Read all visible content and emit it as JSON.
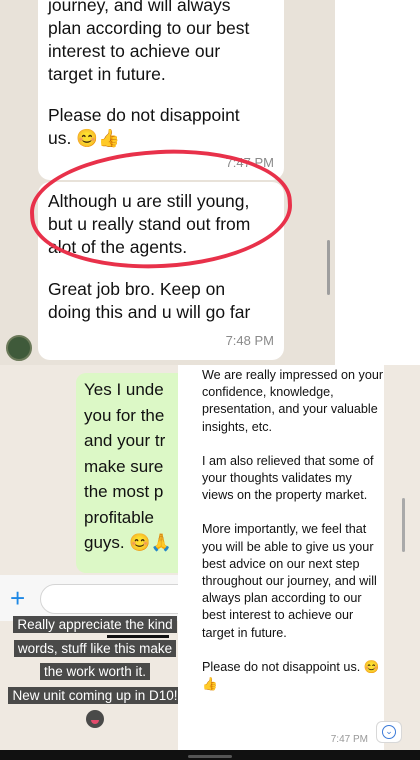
{
  "top_chat": {
    "message1": {
      "lines": [
        "journey, and will always",
        "plan according to our best",
        "interest to achieve our",
        "target in future."
      ],
      "line2": "Please do not disappoint",
      "line3": "us. 😊👍",
      "time": "7:47 PM"
    },
    "message2": {
      "para1": [
        "Although u are still young,",
        "but u really stand out from",
        "alot of the agents."
      ],
      "para2": [
        "Great job bro. Keep on",
        "doing this and u will go far"
      ],
      "time": "7:48 PM"
    }
  },
  "reply_bubble": {
    "lines": [
      "Yes I unde",
      "you for the",
      "and your tr",
      "make sure",
      "the most p",
      "profitable",
      "guys. 😊🙏"
    ]
  },
  "caption": {
    "line1": "Really appreciate the kind",
    "line2": "words, stuff like this make",
    "line3": "the work worth it.",
    "line4": "New unit coming up in D10!"
  },
  "note": {
    "para1": "We are really impressed on your confidence, knowledge, presentation, and your valuable insights, etc.",
    "para2": "I am also relieved that some of your thoughts validates my views on the property market.",
    "para3": "More importantly, we feel that you will be able to give us your best advice on our next step throughout our journey, and will always plan according to our best interest to achieve our target in future.",
    "para4": "Please do not disappoint us. 😊👍",
    "time": "7:47 PM"
  },
  "colors": {
    "highlight_circle": "#e8314a",
    "outgoing_bubble": "#dcf8c6",
    "accent": "#1e88e5"
  },
  "icons": [
    "plus-icon",
    "scroll-down-icon",
    "avatar"
  ]
}
